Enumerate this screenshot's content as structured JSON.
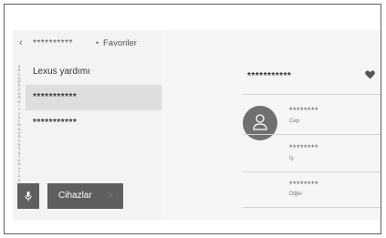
{
  "breadcrumb": {
    "back_icon": "chevron-left-icon",
    "masked_name": "**********",
    "separator": "•",
    "current": "Favoriler"
  },
  "index_letters": [
    "A",
    "B",
    "C",
    "Ç",
    "D",
    "E",
    "F",
    "G",
    "Ğ",
    "H",
    "I",
    "İ",
    "J",
    "K",
    "L",
    "M",
    "N",
    "O",
    "Ö",
    "P",
    "R",
    "S",
    "Ş",
    "T",
    "U",
    "Ü",
    "V",
    "Y",
    "Z",
    "#"
  ],
  "contacts": [
    {
      "label": "Lexus yardımı"
    },
    {
      "label": "***********"
    },
    {
      "label": "***********"
    }
  ],
  "buttons": {
    "mic_icon": "microphone-icon",
    "devices_label": "Cihazlar",
    "devices_close": "✕"
  },
  "detail": {
    "name": "***********",
    "favorite_icon": "heart-icon",
    "avatar_icon": "person-icon",
    "numbers": [
      {
        "number": "********",
        "type": "Cep"
      },
      {
        "number": "********",
        "type": "İş"
      },
      {
        "number": "********",
        "type": "Diğer"
      }
    ]
  }
}
